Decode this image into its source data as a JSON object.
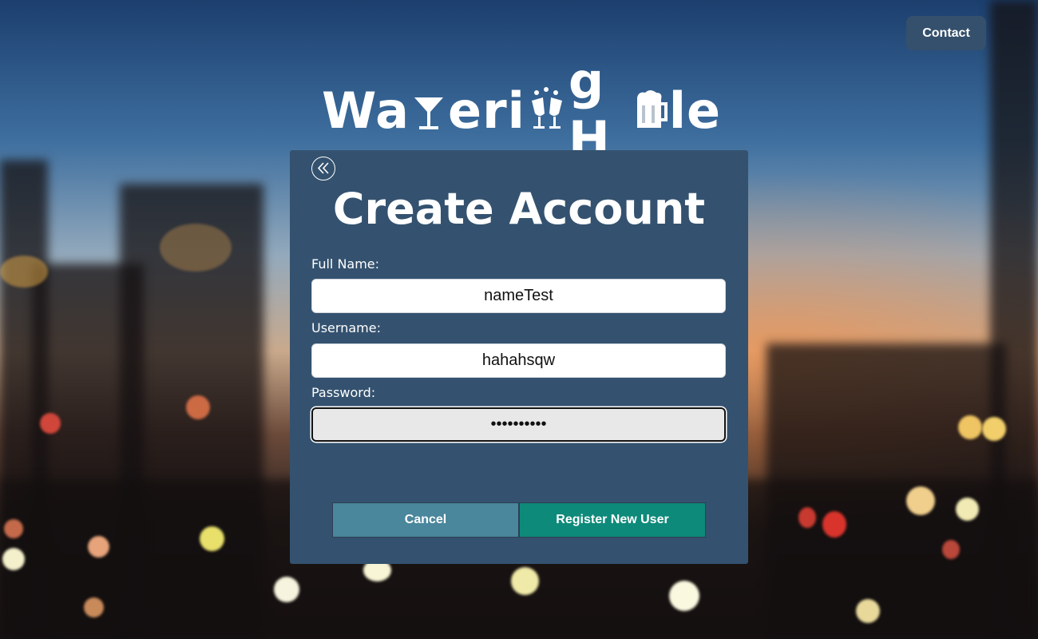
{
  "header": {
    "contact_label": "Contact"
  },
  "logo": {
    "text_part1": "Wa",
    "text_part2": "eri",
    "text_part3": "g H",
    "text_part4": "le"
  },
  "form": {
    "title": "Create Account",
    "full_name": {
      "label": "Full Name:",
      "value": "nameTest"
    },
    "username": {
      "label": "Username:",
      "value": "hahahsqw"
    },
    "password": {
      "label": "Password:",
      "value": "••••••••••"
    },
    "cancel_label": "Cancel",
    "register_label": "Register New User"
  },
  "icons": {
    "back": "double-chevron-left-icon",
    "cocktail": "cocktail-glass-icon",
    "cheers": "cheers-glasses-icon",
    "beer": "beer-mug-icon"
  }
}
